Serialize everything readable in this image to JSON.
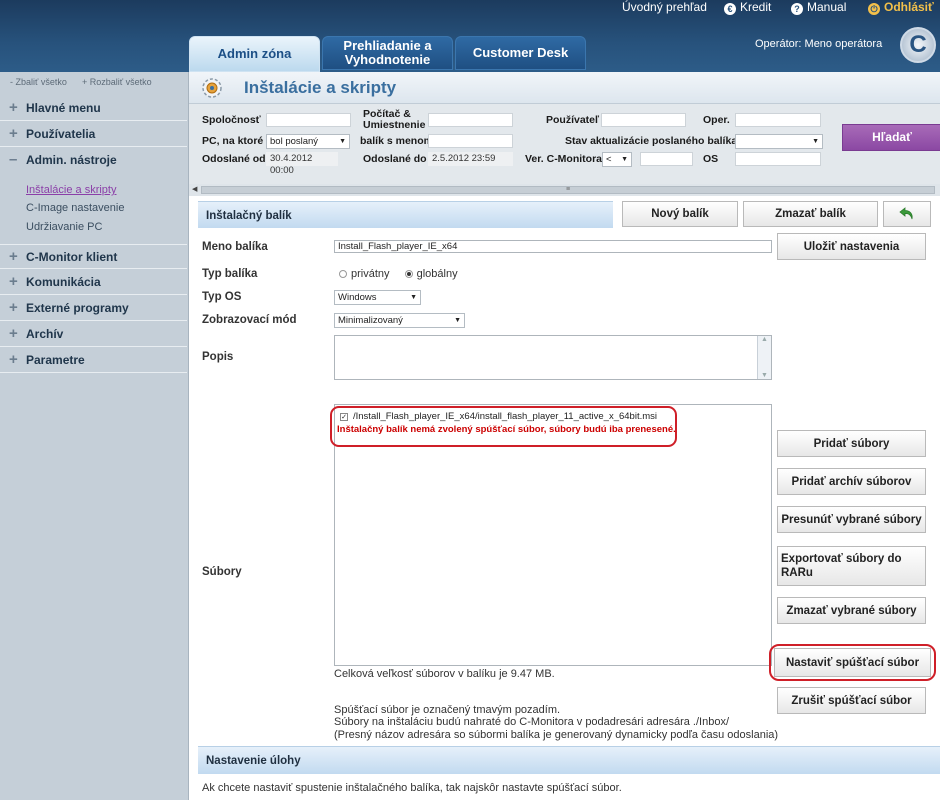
{
  "topbar": {
    "overview": "Úvodný prehľad",
    "credit": "Kredit",
    "manual": "Manual",
    "logout": "Odhlásiť",
    "credit_icon": "€",
    "manual_icon": "?",
    "logout_icon": "⏻"
  },
  "tabs": [
    {
      "label": "Admin zóna"
    },
    {
      "label": "Prehliadanie a Vyhodnotenie"
    },
    {
      "label": "Customer Desk"
    }
  ],
  "operator": {
    "prefix": "Operátor:",
    "name": "Meno operátora"
  },
  "logo": "C",
  "sidebar": {
    "collapse_all": "Zbaliť všetko",
    "expand_all": "Rozbaliť všetko",
    "groups": [
      {
        "label": "Hlavné menu",
        "marker": "+"
      },
      {
        "label": "Používatelia",
        "marker": "+"
      },
      {
        "label": "Admin. nástroje",
        "marker": "–"
      },
      {
        "label": "C-Monitor klient",
        "marker": "+"
      },
      {
        "label": "Komunikácia",
        "marker": "+"
      },
      {
        "label": "Externé programy",
        "marker": "+"
      },
      {
        "label": "Archív",
        "marker": "+"
      },
      {
        "label": "Parametre",
        "marker": "+"
      }
    ],
    "subitems": [
      {
        "label": "Inštalácie a skripty"
      },
      {
        "label": "C-Image nastavenie"
      },
      {
        "label": "Udržiavanie PC"
      }
    ]
  },
  "page": {
    "title": "Inštalácie a skripty"
  },
  "filters": {
    "company": "Spoločnosť",
    "computer": "Počítač & Umiestnenie",
    "user": "Používateľ",
    "oper": "Oper.",
    "pc_label": "PC, na ktoré",
    "pc_value": "bol poslaný",
    "package_name": "balík s menom",
    "state_label": "Stav aktualizácie poslaného balíka je",
    "sent_from": "Odoslané od",
    "sent_from_value": "30.4.2012 00:00",
    "sent_to": "Odoslané do",
    "sent_to_value": "2.5.2012 23:59",
    "version_label": "Ver. C-Monitora",
    "version_op": "<",
    "os_label": "OS",
    "search_button": "Hľadať"
  },
  "splitter_grip": "≡",
  "package": {
    "section_title": "Inštalačný balík",
    "new_button": "Nový balík",
    "delete_button": "Zmazať balík",
    "save_button": "Uložiť nastavenia",
    "name_label": "Meno balíka",
    "name_value": "Install_Flash_player_IE_x64",
    "type_label": "Typ balíka",
    "type_private": "privátny",
    "type_global": "globálny",
    "os_label": "Typ OS",
    "os_value": "Windows",
    "mode_label": "Zobrazovací mód",
    "mode_value": "Minimalizovaný",
    "desc_label": "Popis",
    "desc_value": "",
    "files_label": "Súbory",
    "file_path": "/Install_Flash_player_IE_x64/install_flash_player_11_active_x_64bit.msi",
    "file_warning": "Inštalačný balík nemá zvolený spúšťací súbor, súbory budú iba prenesené.",
    "total_size": "Celková veľkosť súborov v balíku je 9.47 MB.",
    "note1": "Spúšťací súbor je označený tmavým pozadím.",
    "note2": "Súbory na inštaláciu budú nahraté do C-Monitora v podadresári adresára ./Inbox/",
    "note3": "(Presný názov adresára so súbormi balíka je generovaný dynamicky podľa času odoslania)"
  },
  "file_buttons": {
    "add_files": "Pridať súbory",
    "add_archive": "Pridať archív súborov",
    "move_selected": "Presunúť vybrané súbory",
    "export_rar": "Exportovať súbory do RARu",
    "delete_selected": "Zmazať vybrané súbory",
    "set_launch": "Nastaviť spúšťací súbor",
    "cancel_launch": "Zrušiť spúšťací súbor"
  },
  "task": {
    "section_title": "Nastavenie úlohy",
    "info": "Ak chcete nastaviť spustenie inštalačného balíka, tak najskôr nastavte spúšťací súbor."
  },
  "colors": {
    "header_bg": "#27527c",
    "accent": "#3a6f9f",
    "search_btn": "#9a58ae",
    "warning": "#cc0000",
    "highlight_ring": "#cf1f28",
    "back_arrow": "#3a9a3a"
  }
}
